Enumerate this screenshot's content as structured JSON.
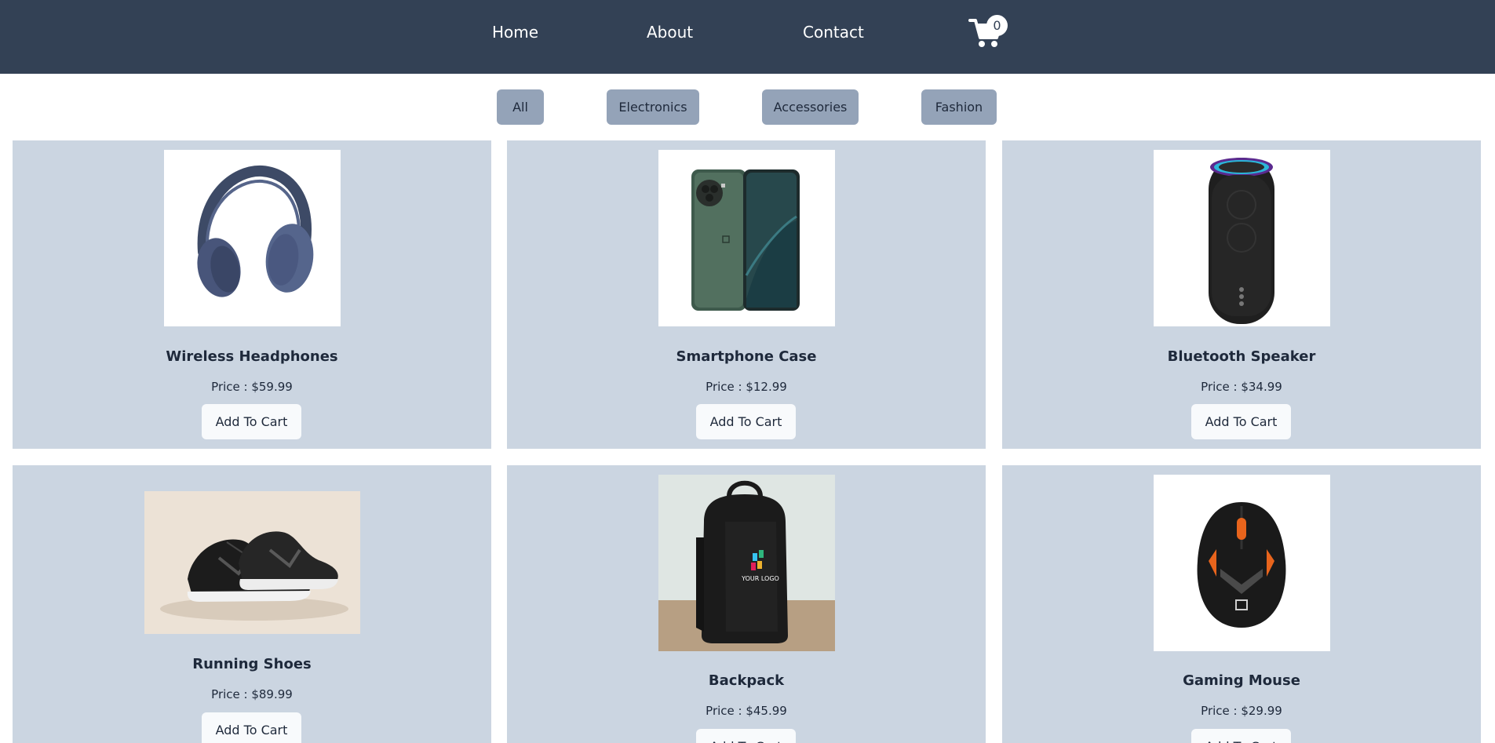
{
  "nav": {
    "items": [
      {
        "label": "Home"
      },
      {
        "label": "About"
      },
      {
        "label": "Contact"
      }
    ],
    "cart": {
      "icon": "cart-icon",
      "count": "0"
    }
  },
  "filters": [
    {
      "label": "All"
    },
    {
      "label": "Electronics"
    },
    {
      "label": "Accessories"
    },
    {
      "label": "Fashion"
    }
  ],
  "products": [
    {
      "name": "Wireless Headphones",
      "price": "Price : $59.99",
      "button": "Add To Cart",
      "image": "headphones-image"
    },
    {
      "name": "Smartphone Case",
      "price": "Price : $12.99",
      "button": "Add To Cart",
      "image": "smartphone-image"
    },
    {
      "name": "Bluetooth Speaker",
      "price": "Price : $34.99",
      "button": "Add To Cart",
      "image": "speaker-image"
    },
    {
      "name": "Running Shoes",
      "price": "Price : $89.99",
      "button": "Add To Cart",
      "image": "shoes-image"
    },
    {
      "name": "Backpack",
      "price": "Price : $45.99",
      "button": "Add To Cart",
      "image": "backpack-image",
      "image_text": "YOUR LOGO"
    },
    {
      "name": "Gaming Mouse",
      "price": "Price : $29.99",
      "button": "Add To Cart",
      "image": "mouse-image"
    }
  ],
  "colors": {
    "header": "#334155",
    "card": "#cbd5e1",
    "filter": "#94a3b8",
    "button": "#f8fafc",
    "text": "#1e293b"
  }
}
